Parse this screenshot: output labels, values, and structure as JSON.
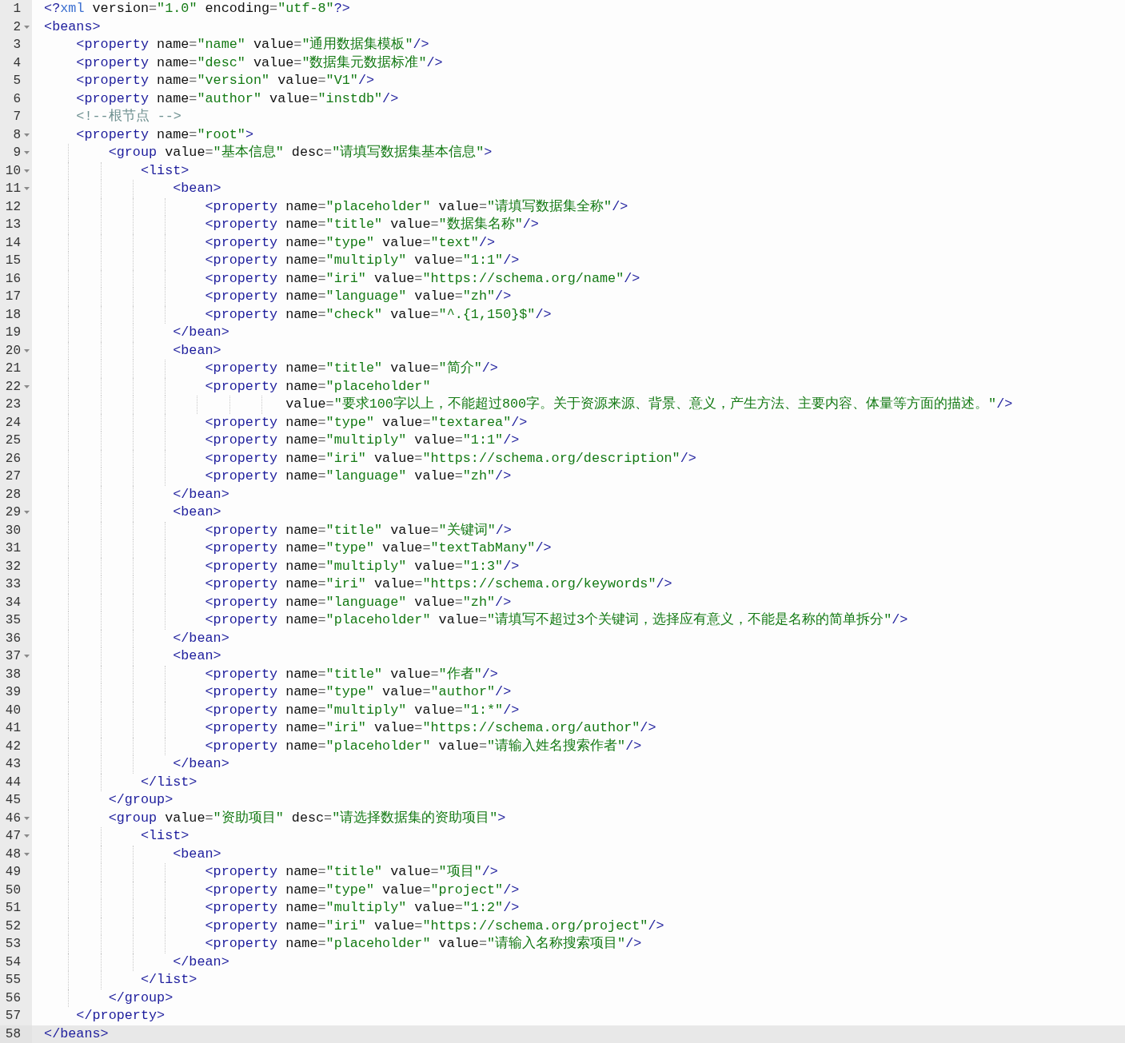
{
  "editor": {
    "lines": [
      {
        "number": "1",
        "foldable": false,
        "active": false,
        "tokens": [
          {
            "kind": "tag",
            "text": "<?"
          },
          {
            "kind": "pi",
            "text": "xml"
          },
          {
            "kind": "attr",
            "text": " version"
          },
          {
            "kind": "op",
            "text": "="
          },
          {
            "kind": "str",
            "text": "\"1.0\""
          },
          {
            "kind": "attr",
            "text": " encoding"
          },
          {
            "kind": "op",
            "text": "="
          },
          {
            "kind": "str",
            "text": "\"utf-8\""
          },
          {
            "kind": "tag",
            "text": "?>"
          }
        ]
      },
      {
        "number": "2",
        "foldable": true,
        "active": false,
        "tokens": [
          {
            "kind": "tag",
            "text": "<beans>"
          }
        ]
      },
      {
        "number": "3",
        "foldable": false,
        "active": false,
        "tokens": [
          {
            "kind": "tag",
            "text": "    <property"
          },
          {
            "kind": "attr",
            "text": " name"
          },
          {
            "kind": "op",
            "text": "="
          },
          {
            "kind": "str",
            "text": "\"name\""
          },
          {
            "kind": "attr",
            "text": " value"
          },
          {
            "kind": "op",
            "text": "="
          },
          {
            "kind": "str",
            "text": "\"通用数据集模板\""
          },
          {
            "kind": "tag",
            "text": "/>"
          }
        ]
      },
      {
        "number": "4",
        "foldable": false,
        "active": false,
        "tokens": [
          {
            "kind": "tag",
            "text": "    <property"
          },
          {
            "kind": "attr",
            "text": " name"
          },
          {
            "kind": "op",
            "text": "="
          },
          {
            "kind": "str",
            "text": "\"desc\""
          },
          {
            "kind": "attr",
            "text": " value"
          },
          {
            "kind": "op",
            "text": "="
          },
          {
            "kind": "str",
            "text": "\"数据集元数据标准\""
          },
          {
            "kind": "tag",
            "text": "/>"
          }
        ]
      },
      {
        "number": "5",
        "foldable": false,
        "active": false,
        "tokens": [
          {
            "kind": "tag",
            "text": "    <property"
          },
          {
            "kind": "attr",
            "text": " name"
          },
          {
            "kind": "op",
            "text": "="
          },
          {
            "kind": "str",
            "text": "\"version\""
          },
          {
            "kind": "attr",
            "text": " value"
          },
          {
            "kind": "op",
            "text": "="
          },
          {
            "kind": "str",
            "text": "\"V1\""
          },
          {
            "kind": "tag",
            "text": "/>"
          }
        ]
      },
      {
        "number": "6",
        "foldable": false,
        "active": false,
        "tokens": [
          {
            "kind": "tag",
            "text": "    <property"
          },
          {
            "kind": "attr",
            "text": " name"
          },
          {
            "kind": "op",
            "text": "="
          },
          {
            "kind": "str",
            "text": "\"author\""
          },
          {
            "kind": "attr",
            "text": " value"
          },
          {
            "kind": "op",
            "text": "="
          },
          {
            "kind": "str",
            "text": "\"instdb\""
          },
          {
            "kind": "tag",
            "text": "/>"
          }
        ]
      },
      {
        "number": "7",
        "foldable": false,
        "active": false,
        "tokens": [
          {
            "kind": "comment",
            "text": "    <!--根节点 -->"
          }
        ]
      },
      {
        "number": "8",
        "foldable": true,
        "active": false,
        "tokens": [
          {
            "kind": "tag",
            "text": "    <property"
          },
          {
            "kind": "attr",
            "text": " name"
          },
          {
            "kind": "op",
            "text": "="
          },
          {
            "kind": "str",
            "text": "\"root\""
          },
          {
            "kind": "tag",
            "text": ">"
          }
        ]
      },
      {
        "number": "9",
        "foldable": true,
        "active": false,
        "tokens": [
          {
            "kind": "tag",
            "text": "        <group"
          },
          {
            "kind": "attr",
            "text": " value"
          },
          {
            "kind": "op",
            "text": "="
          },
          {
            "kind": "str",
            "text": "\"基本信息\""
          },
          {
            "kind": "attr",
            "text": " desc"
          },
          {
            "kind": "op",
            "text": "="
          },
          {
            "kind": "str",
            "text": "\"请填写数据集基本信息\""
          },
          {
            "kind": "tag",
            "text": ">"
          }
        ]
      },
      {
        "number": "10",
        "foldable": true,
        "active": false,
        "tokens": [
          {
            "kind": "tag",
            "text": "            <list>"
          }
        ]
      },
      {
        "number": "11",
        "foldable": true,
        "active": false,
        "tokens": [
          {
            "kind": "tag",
            "text": "                <bean>"
          }
        ]
      },
      {
        "number": "12",
        "foldable": false,
        "active": false,
        "tokens": [
          {
            "kind": "tag",
            "text": "                    <property"
          },
          {
            "kind": "attr",
            "text": " name"
          },
          {
            "kind": "op",
            "text": "="
          },
          {
            "kind": "str",
            "text": "\"placeholder\""
          },
          {
            "kind": "attr",
            "text": " value"
          },
          {
            "kind": "op",
            "text": "="
          },
          {
            "kind": "str",
            "text": "\"请填写数据集全称\""
          },
          {
            "kind": "tag",
            "text": "/>"
          }
        ]
      },
      {
        "number": "13",
        "foldable": false,
        "active": false,
        "tokens": [
          {
            "kind": "tag",
            "text": "                    <property"
          },
          {
            "kind": "attr",
            "text": " name"
          },
          {
            "kind": "op",
            "text": "="
          },
          {
            "kind": "str",
            "text": "\"title\""
          },
          {
            "kind": "attr",
            "text": " value"
          },
          {
            "kind": "op",
            "text": "="
          },
          {
            "kind": "str",
            "text": "\"数据集名称\""
          },
          {
            "kind": "tag",
            "text": "/>"
          }
        ]
      },
      {
        "number": "14",
        "foldable": false,
        "active": false,
        "tokens": [
          {
            "kind": "tag",
            "text": "                    <property"
          },
          {
            "kind": "attr",
            "text": " name"
          },
          {
            "kind": "op",
            "text": "="
          },
          {
            "kind": "str",
            "text": "\"type\""
          },
          {
            "kind": "attr",
            "text": " value"
          },
          {
            "kind": "op",
            "text": "="
          },
          {
            "kind": "str",
            "text": "\"text\""
          },
          {
            "kind": "tag",
            "text": "/>"
          }
        ]
      },
      {
        "number": "15",
        "foldable": false,
        "active": false,
        "tokens": [
          {
            "kind": "tag",
            "text": "                    <property"
          },
          {
            "kind": "attr",
            "text": " name"
          },
          {
            "kind": "op",
            "text": "="
          },
          {
            "kind": "str",
            "text": "\"multiply\""
          },
          {
            "kind": "attr",
            "text": " value"
          },
          {
            "kind": "op",
            "text": "="
          },
          {
            "kind": "str",
            "text": "\"1:1\""
          },
          {
            "kind": "tag",
            "text": "/>"
          }
        ]
      },
      {
        "number": "16",
        "foldable": false,
        "active": false,
        "tokens": [
          {
            "kind": "tag",
            "text": "                    <property"
          },
          {
            "kind": "attr",
            "text": " name"
          },
          {
            "kind": "op",
            "text": "="
          },
          {
            "kind": "str",
            "text": "\"iri\""
          },
          {
            "kind": "attr",
            "text": " value"
          },
          {
            "kind": "op",
            "text": "="
          },
          {
            "kind": "str",
            "text": "\"https://schema.org/name\""
          },
          {
            "kind": "tag",
            "text": "/>"
          }
        ]
      },
      {
        "number": "17",
        "foldable": false,
        "active": false,
        "tokens": [
          {
            "kind": "tag",
            "text": "                    <property"
          },
          {
            "kind": "attr",
            "text": " name"
          },
          {
            "kind": "op",
            "text": "="
          },
          {
            "kind": "str",
            "text": "\"language\""
          },
          {
            "kind": "attr",
            "text": " value"
          },
          {
            "kind": "op",
            "text": "="
          },
          {
            "kind": "str",
            "text": "\"zh\""
          },
          {
            "kind": "tag",
            "text": "/>"
          }
        ]
      },
      {
        "number": "18",
        "foldable": false,
        "active": false,
        "tokens": [
          {
            "kind": "tag",
            "text": "                    <property"
          },
          {
            "kind": "attr",
            "text": " name"
          },
          {
            "kind": "op",
            "text": "="
          },
          {
            "kind": "str",
            "text": "\"check\""
          },
          {
            "kind": "attr",
            "text": " value"
          },
          {
            "kind": "op",
            "text": "="
          },
          {
            "kind": "str",
            "text": "\"^.{1,150}$\""
          },
          {
            "kind": "tag",
            "text": "/>"
          }
        ]
      },
      {
        "number": "19",
        "foldable": false,
        "active": false,
        "tokens": [
          {
            "kind": "tag",
            "text": "                </bean>"
          }
        ]
      },
      {
        "number": "20",
        "foldable": true,
        "active": false,
        "tokens": [
          {
            "kind": "tag",
            "text": "                <bean>"
          }
        ]
      },
      {
        "number": "21",
        "foldable": false,
        "active": false,
        "tokens": [
          {
            "kind": "tag",
            "text": "                    <property"
          },
          {
            "kind": "attr",
            "text": " name"
          },
          {
            "kind": "op",
            "text": "="
          },
          {
            "kind": "str",
            "text": "\"title\""
          },
          {
            "kind": "attr",
            "text": " value"
          },
          {
            "kind": "op",
            "text": "="
          },
          {
            "kind": "str",
            "text": "\"简介\""
          },
          {
            "kind": "tag",
            "text": "/>"
          }
        ]
      },
      {
        "number": "22",
        "foldable": true,
        "active": false,
        "tokens": [
          {
            "kind": "tag",
            "text": "                    <property"
          },
          {
            "kind": "attr",
            "text": " name"
          },
          {
            "kind": "op",
            "text": "="
          },
          {
            "kind": "str",
            "text": "\"placeholder\""
          }
        ]
      },
      {
        "number": "23",
        "foldable": false,
        "active": false,
        "tokens": [
          {
            "kind": "attr",
            "text": "                              value"
          },
          {
            "kind": "op",
            "text": "="
          },
          {
            "kind": "str",
            "text": "\"要求100字以上，不能超过800字。关于资源来源、背景、意义，产生方法、主要内容、体量等方面的描述。\""
          },
          {
            "kind": "tag",
            "text": "/>"
          }
        ]
      },
      {
        "number": "24",
        "foldable": false,
        "active": false,
        "tokens": [
          {
            "kind": "tag",
            "text": "                    <property"
          },
          {
            "kind": "attr",
            "text": " name"
          },
          {
            "kind": "op",
            "text": "="
          },
          {
            "kind": "str",
            "text": "\"type\""
          },
          {
            "kind": "attr",
            "text": " value"
          },
          {
            "kind": "op",
            "text": "="
          },
          {
            "kind": "str",
            "text": "\"textarea\""
          },
          {
            "kind": "tag",
            "text": "/>"
          }
        ]
      },
      {
        "number": "25",
        "foldable": false,
        "active": false,
        "tokens": [
          {
            "kind": "tag",
            "text": "                    <property"
          },
          {
            "kind": "attr",
            "text": " name"
          },
          {
            "kind": "op",
            "text": "="
          },
          {
            "kind": "str",
            "text": "\"multiply\""
          },
          {
            "kind": "attr",
            "text": " value"
          },
          {
            "kind": "op",
            "text": "="
          },
          {
            "kind": "str",
            "text": "\"1:1\""
          },
          {
            "kind": "tag",
            "text": "/>"
          }
        ]
      },
      {
        "number": "26",
        "foldable": false,
        "active": false,
        "tokens": [
          {
            "kind": "tag",
            "text": "                    <property"
          },
          {
            "kind": "attr",
            "text": " name"
          },
          {
            "kind": "op",
            "text": "="
          },
          {
            "kind": "str",
            "text": "\"iri\""
          },
          {
            "kind": "attr",
            "text": " value"
          },
          {
            "kind": "op",
            "text": "="
          },
          {
            "kind": "str",
            "text": "\"https://schema.org/description\""
          },
          {
            "kind": "tag",
            "text": "/>"
          }
        ]
      },
      {
        "number": "27",
        "foldable": false,
        "active": false,
        "tokens": [
          {
            "kind": "tag",
            "text": "                    <property"
          },
          {
            "kind": "attr",
            "text": " name"
          },
          {
            "kind": "op",
            "text": "="
          },
          {
            "kind": "str",
            "text": "\"language\""
          },
          {
            "kind": "attr",
            "text": " value"
          },
          {
            "kind": "op",
            "text": "="
          },
          {
            "kind": "str",
            "text": "\"zh\""
          },
          {
            "kind": "tag",
            "text": "/>"
          }
        ]
      },
      {
        "number": "28",
        "foldable": false,
        "active": false,
        "tokens": [
          {
            "kind": "tag",
            "text": "                </bean>"
          }
        ]
      },
      {
        "number": "29",
        "foldable": true,
        "active": false,
        "tokens": [
          {
            "kind": "tag",
            "text": "                <bean>"
          }
        ]
      },
      {
        "number": "30",
        "foldable": false,
        "active": false,
        "tokens": [
          {
            "kind": "tag",
            "text": "                    <property"
          },
          {
            "kind": "attr",
            "text": " name"
          },
          {
            "kind": "op",
            "text": "="
          },
          {
            "kind": "str",
            "text": "\"title\""
          },
          {
            "kind": "attr",
            "text": " value"
          },
          {
            "kind": "op",
            "text": "="
          },
          {
            "kind": "str",
            "text": "\"关键词\""
          },
          {
            "kind": "tag",
            "text": "/>"
          }
        ]
      },
      {
        "number": "31",
        "foldable": false,
        "active": false,
        "tokens": [
          {
            "kind": "tag",
            "text": "                    <property"
          },
          {
            "kind": "attr",
            "text": " name"
          },
          {
            "kind": "op",
            "text": "="
          },
          {
            "kind": "str",
            "text": "\"type\""
          },
          {
            "kind": "attr",
            "text": " value"
          },
          {
            "kind": "op",
            "text": "="
          },
          {
            "kind": "str",
            "text": "\"textTabMany\""
          },
          {
            "kind": "tag",
            "text": "/>"
          }
        ]
      },
      {
        "number": "32",
        "foldable": false,
        "active": false,
        "tokens": [
          {
            "kind": "tag",
            "text": "                    <property"
          },
          {
            "kind": "attr",
            "text": " name"
          },
          {
            "kind": "op",
            "text": "="
          },
          {
            "kind": "str",
            "text": "\"multiply\""
          },
          {
            "kind": "attr",
            "text": " value"
          },
          {
            "kind": "op",
            "text": "="
          },
          {
            "kind": "str",
            "text": "\"1:3\""
          },
          {
            "kind": "tag",
            "text": "/>"
          }
        ]
      },
      {
        "number": "33",
        "foldable": false,
        "active": false,
        "tokens": [
          {
            "kind": "tag",
            "text": "                    <property"
          },
          {
            "kind": "attr",
            "text": " name"
          },
          {
            "kind": "op",
            "text": "="
          },
          {
            "kind": "str",
            "text": "\"iri\""
          },
          {
            "kind": "attr",
            "text": " value"
          },
          {
            "kind": "op",
            "text": "="
          },
          {
            "kind": "str",
            "text": "\"https://schema.org/keywords\""
          },
          {
            "kind": "tag",
            "text": "/>"
          }
        ]
      },
      {
        "number": "34",
        "foldable": false,
        "active": false,
        "tokens": [
          {
            "kind": "tag",
            "text": "                    <property"
          },
          {
            "kind": "attr",
            "text": " name"
          },
          {
            "kind": "op",
            "text": "="
          },
          {
            "kind": "str",
            "text": "\"language\""
          },
          {
            "kind": "attr",
            "text": " value"
          },
          {
            "kind": "op",
            "text": "="
          },
          {
            "kind": "str",
            "text": "\"zh\""
          },
          {
            "kind": "tag",
            "text": "/>"
          }
        ]
      },
      {
        "number": "35",
        "foldable": false,
        "active": false,
        "tokens": [
          {
            "kind": "tag",
            "text": "                    <property"
          },
          {
            "kind": "attr",
            "text": " name"
          },
          {
            "kind": "op",
            "text": "="
          },
          {
            "kind": "str",
            "text": "\"placeholder\""
          },
          {
            "kind": "attr",
            "text": " value"
          },
          {
            "kind": "op",
            "text": "="
          },
          {
            "kind": "str",
            "text": "\"请填写不超过3个关键词，选择应有意义，不能是名称的简单拆分\""
          },
          {
            "kind": "tag",
            "text": "/>"
          }
        ]
      },
      {
        "number": "36",
        "foldable": false,
        "active": false,
        "tokens": [
          {
            "kind": "tag",
            "text": "                </bean>"
          }
        ]
      },
      {
        "number": "37",
        "foldable": true,
        "active": false,
        "tokens": [
          {
            "kind": "tag",
            "text": "                <bean>"
          }
        ]
      },
      {
        "number": "38",
        "foldable": false,
        "active": false,
        "tokens": [
          {
            "kind": "tag",
            "text": "                    <property"
          },
          {
            "kind": "attr",
            "text": " name"
          },
          {
            "kind": "op",
            "text": "="
          },
          {
            "kind": "str",
            "text": "\"title\""
          },
          {
            "kind": "attr",
            "text": " value"
          },
          {
            "kind": "op",
            "text": "="
          },
          {
            "kind": "str",
            "text": "\"作者\""
          },
          {
            "kind": "tag",
            "text": "/>"
          }
        ]
      },
      {
        "number": "39",
        "foldable": false,
        "active": false,
        "tokens": [
          {
            "kind": "tag",
            "text": "                    <property"
          },
          {
            "kind": "attr",
            "text": " name"
          },
          {
            "kind": "op",
            "text": "="
          },
          {
            "kind": "str",
            "text": "\"type\""
          },
          {
            "kind": "attr",
            "text": " value"
          },
          {
            "kind": "op",
            "text": "="
          },
          {
            "kind": "str",
            "text": "\"author\""
          },
          {
            "kind": "tag",
            "text": "/>"
          }
        ]
      },
      {
        "number": "40",
        "foldable": false,
        "active": false,
        "tokens": [
          {
            "kind": "tag",
            "text": "                    <property"
          },
          {
            "kind": "attr",
            "text": " name"
          },
          {
            "kind": "op",
            "text": "="
          },
          {
            "kind": "str",
            "text": "\"multiply\""
          },
          {
            "kind": "attr",
            "text": " value"
          },
          {
            "kind": "op",
            "text": "="
          },
          {
            "kind": "str",
            "text": "\"1:*\""
          },
          {
            "kind": "tag",
            "text": "/>"
          }
        ]
      },
      {
        "number": "41",
        "foldable": false,
        "active": false,
        "tokens": [
          {
            "kind": "tag",
            "text": "                    <property"
          },
          {
            "kind": "attr",
            "text": " name"
          },
          {
            "kind": "op",
            "text": "="
          },
          {
            "kind": "str",
            "text": "\"iri\""
          },
          {
            "kind": "attr",
            "text": " value"
          },
          {
            "kind": "op",
            "text": "="
          },
          {
            "kind": "str",
            "text": "\"https://schema.org/author\""
          },
          {
            "kind": "tag",
            "text": "/>"
          }
        ]
      },
      {
        "number": "42",
        "foldable": false,
        "active": false,
        "tokens": [
          {
            "kind": "tag",
            "text": "                    <property"
          },
          {
            "kind": "attr",
            "text": " name"
          },
          {
            "kind": "op",
            "text": "="
          },
          {
            "kind": "str",
            "text": "\"placeholder\""
          },
          {
            "kind": "attr",
            "text": " value"
          },
          {
            "kind": "op",
            "text": "="
          },
          {
            "kind": "str",
            "text": "\"请输入姓名搜索作者\""
          },
          {
            "kind": "tag",
            "text": "/>"
          }
        ]
      },
      {
        "number": "43",
        "foldable": false,
        "active": false,
        "tokens": [
          {
            "kind": "tag",
            "text": "                </bean>"
          }
        ]
      },
      {
        "number": "44",
        "foldable": false,
        "active": false,
        "tokens": [
          {
            "kind": "tag",
            "text": "            </list>"
          }
        ]
      },
      {
        "number": "45",
        "foldable": false,
        "active": false,
        "tokens": [
          {
            "kind": "tag",
            "text": "        </group>"
          }
        ]
      },
      {
        "number": "46",
        "foldable": true,
        "active": false,
        "tokens": [
          {
            "kind": "tag",
            "text": "        <group"
          },
          {
            "kind": "attr",
            "text": " value"
          },
          {
            "kind": "op",
            "text": "="
          },
          {
            "kind": "str",
            "text": "\"资助项目\""
          },
          {
            "kind": "attr",
            "text": " desc"
          },
          {
            "kind": "op",
            "text": "="
          },
          {
            "kind": "str",
            "text": "\"请选择数据集的资助项目\""
          },
          {
            "kind": "tag",
            "text": ">"
          }
        ]
      },
      {
        "number": "47",
        "foldable": true,
        "active": false,
        "tokens": [
          {
            "kind": "tag",
            "text": "            <list>"
          }
        ]
      },
      {
        "number": "48",
        "foldable": true,
        "active": false,
        "tokens": [
          {
            "kind": "tag",
            "text": "                <bean>"
          }
        ]
      },
      {
        "number": "49",
        "foldable": false,
        "active": false,
        "tokens": [
          {
            "kind": "tag",
            "text": "                    <property"
          },
          {
            "kind": "attr",
            "text": " name"
          },
          {
            "kind": "op",
            "text": "="
          },
          {
            "kind": "str",
            "text": "\"title\""
          },
          {
            "kind": "attr",
            "text": " value"
          },
          {
            "kind": "op",
            "text": "="
          },
          {
            "kind": "str",
            "text": "\"项目\""
          },
          {
            "kind": "tag",
            "text": "/>"
          }
        ]
      },
      {
        "number": "50",
        "foldable": false,
        "active": false,
        "tokens": [
          {
            "kind": "tag",
            "text": "                    <property"
          },
          {
            "kind": "attr",
            "text": " name"
          },
          {
            "kind": "op",
            "text": "="
          },
          {
            "kind": "str",
            "text": "\"type\""
          },
          {
            "kind": "attr",
            "text": " value"
          },
          {
            "kind": "op",
            "text": "="
          },
          {
            "kind": "str",
            "text": "\"project\""
          },
          {
            "kind": "tag",
            "text": "/>"
          }
        ]
      },
      {
        "number": "51",
        "foldable": false,
        "active": false,
        "tokens": [
          {
            "kind": "tag",
            "text": "                    <property"
          },
          {
            "kind": "attr",
            "text": " name"
          },
          {
            "kind": "op",
            "text": "="
          },
          {
            "kind": "str",
            "text": "\"multiply\""
          },
          {
            "kind": "attr",
            "text": " value"
          },
          {
            "kind": "op",
            "text": "="
          },
          {
            "kind": "str",
            "text": "\"1:2\""
          },
          {
            "kind": "tag",
            "text": "/>"
          }
        ]
      },
      {
        "number": "52",
        "foldable": false,
        "active": false,
        "tokens": [
          {
            "kind": "tag",
            "text": "                    <property"
          },
          {
            "kind": "attr",
            "text": " name"
          },
          {
            "kind": "op",
            "text": "="
          },
          {
            "kind": "str",
            "text": "\"iri\""
          },
          {
            "kind": "attr",
            "text": " value"
          },
          {
            "kind": "op",
            "text": "="
          },
          {
            "kind": "str",
            "text": "\"https://schema.org/project\""
          },
          {
            "kind": "tag",
            "text": "/>"
          }
        ]
      },
      {
        "number": "53",
        "foldable": false,
        "active": false,
        "tokens": [
          {
            "kind": "tag",
            "text": "                    <property"
          },
          {
            "kind": "attr",
            "text": " name"
          },
          {
            "kind": "op",
            "text": "="
          },
          {
            "kind": "str",
            "text": "\"placeholder\""
          },
          {
            "kind": "attr",
            "text": " value"
          },
          {
            "kind": "op",
            "text": "="
          },
          {
            "kind": "str",
            "text": "\"请输入名称搜索项目\""
          },
          {
            "kind": "tag",
            "text": "/>"
          }
        ]
      },
      {
        "number": "54",
        "foldable": false,
        "active": false,
        "tokens": [
          {
            "kind": "tag",
            "text": "                </bean>"
          }
        ]
      },
      {
        "number": "55",
        "foldable": false,
        "active": false,
        "tokens": [
          {
            "kind": "tag",
            "text": "            </list>"
          }
        ]
      },
      {
        "number": "56",
        "foldable": false,
        "active": false,
        "tokens": [
          {
            "kind": "tag",
            "text": "        </group>"
          }
        ]
      },
      {
        "number": "57",
        "foldable": false,
        "active": false,
        "tokens": [
          {
            "kind": "tag",
            "text": "    </property>"
          }
        ]
      },
      {
        "number": "58",
        "foldable": false,
        "active": true,
        "tokens": [
          {
            "kind": "tag",
            "text": "</beans>"
          }
        ]
      }
    ]
  }
}
